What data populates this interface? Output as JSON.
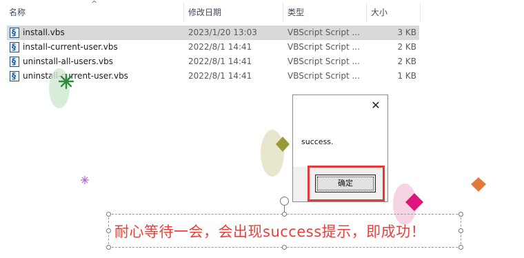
{
  "header": {
    "col_name": "名称",
    "col_date": "修改日期",
    "col_type": "类型",
    "col_size": "大小",
    "sort_indicator": "^"
  },
  "files": [
    {
      "name": "install.vbs",
      "date": "2023/1/20 13:03",
      "type": "VBScript Script ...",
      "size": "3 KB",
      "selected": true
    },
    {
      "name": "install-current-user.vbs",
      "date": "2022/8/1 14:41",
      "type": "VBScript Script ...",
      "size": "2 KB",
      "selected": false
    },
    {
      "name": "uninstall-all-users.vbs",
      "date": "2022/8/1 14:41",
      "type": "VBScript Script ...",
      "size": "2 KB",
      "selected": false
    },
    {
      "name": "uninstall-current-user.vbs",
      "date": "2022/8/1 14:41",
      "type": "VBScript Script ...",
      "size": "1 KB",
      "selected": false
    }
  ],
  "file_icon": "vbs-script-icon",
  "dialog": {
    "message": "success.",
    "ok_label": "确定",
    "close_glyph": "✕"
  },
  "annotation": {
    "text": "耐心等待一会，会出现success提示，即成功！",
    "color": "#e8413b",
    "highlight_color": "#e23b3b"
  }
}
